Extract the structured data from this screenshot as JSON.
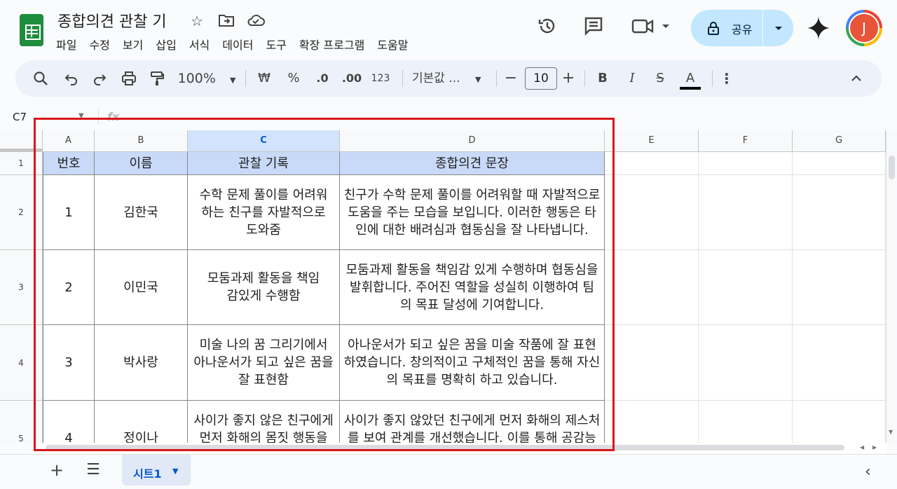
{
  "doc": {
    "title": "종합의견 관찰 기",
    "menu": [
      "파일",
      "수정",
      "보기",
      "삽입",
      "서식",
      "데이터",
      "도구",
      "확장 프로그램",
      "도움말"
    ]
  },
  "header": {
    "share_label": "공유",
    "avatar_letter": "J"
  },
  "toolbar": {
    "zoom": "100%",
    "currency": "₩",
    "percent": "%",
    "decrease_decimal": ".0",
    "increase_decimal": ".00",
    "number_format": "123",
    "font": "기본값 ...",
    "font_size": "10",
    "bold": "B",
    "italic": "I",
    "strikethrough": "S",
    "text_color": "A"
  },
  "formula_bar": {
    "cell_ref": "C7",
    "fx": "fx"
  },
  "grid": {
    "columns": [
      "A",
      "B",
      "C",
      "D",
      "E",
      "F",
      "G"
    ],
    "selected_column": "C",
    "rows": [
      "1",
      "2",
      "3",
      "4",
      "5"
    ],
    "header_row": [
      "번호",
      "이름",
      "관찰 기록",
      "종합의견 문장"
    ],
    "data_rows": [
      [
        "1",
        "김한국",
        "수학 문제 풀이를 어려워하는 친구를 자발적으로 도와줌",
        "친구가 수학 문제 풀이를 어려워할 때 자발적으로 도움을 주는 모습을 보입니다. 이러한 행동은 타인에 대한 배려심과 협동심을 잘 나타냅니다."
      ],
      [
        "2",
        "이민국",
        "모둠과제 활동을 책임감있게 수행함",
        "모둠과제 활동을 책임감 있게 수행하며 협동심을 발휘합니다. 주어진 역할을 성실히 이행하여 팀의 목표 달성에 기여합니다."
      ],
      [
        "3",
        "박사랑",
        "미술 나의 꿈 그리기에서 아나운서가 되고 싶은 꿈을 잘 표현함",
        "아나운서가 되고 싶은 꿈을 미술 작품에 잘 표현하였습니다. 창의적이고 구체적인 꿈을 통해 자신의 목표를 명확히 하고 있습니다."
      ],
      [
        "4",
        "정이나",
        "사이가 좋지 않은 친구에게 먼저 화해의 몸짓 행동을 건네서",
        "사이가 좋지 않았던 친구에게 먼저 화해의 제스처를 보여 관계를 개선했습니다. 이를 통해 공감능력과 배려심을 보여줍니다."
      ]
    ]
  },
  "sheets": {
    "active_tab": "시트1"
  },
  "colors": {
    "header_fill": "#c9daf8",
    "highlight_box": "#d9161b",
    "share_button": "#c2e7ff",
    "sheets_green": "#1e8e3e"
  }
}
